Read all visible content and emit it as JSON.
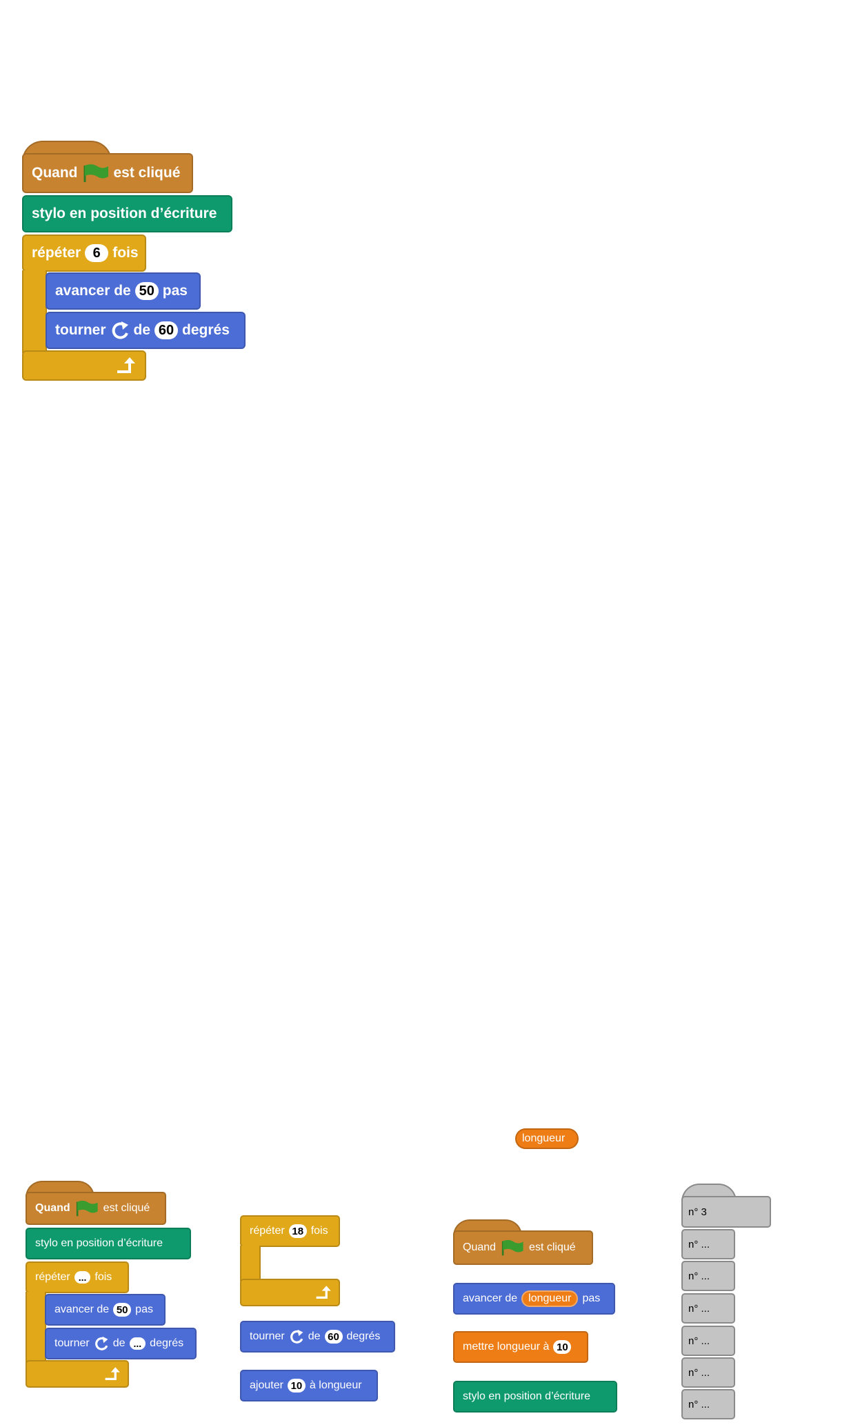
{
  "script1": {
    "hat_pre": "Quand",
    "hat_post": "est cliqué",
    "pen_down": "stylo en position d’écriture",
    "repeat_pre": "répéter",
    "repeat_count": "6",
    "repeat_post": "fois",
    "move_pre": "avancer de",
    "move_steps": "50",
    "move_post": "pas",
    "turn_pre": "tourner",
    "turn_mid": "de",
    "turn_angle": "60",
    "turn_post": "degrés"
  },
  "palette_a": {
    "hat_pre": "Quand",
    "hat_post": "est cliqué",
    "pen_down": "stylo en position d’écriture",
    "repeat_pre": "répéter",
    "repeat_count": "...",
    "repeat_post": "fois",
    "move_pre": "avancer de",
    "move_steps": "50",
    "move_post": "pas",
    "turn_pre": "tourner",
    "turn_mid": "de",
    "turn_angle": "...",
    "turn_post": "degrés"
  },
  "palette_b": {
    "repeat_pre": "répéter",
    "repeat_count": "18",
    "repeat_post": "fois",
    "turn_pre": "tourner",
    "turn_mid": "de",
    "turn_angle": "60",
    "turn_post": "degrés",
    "add_pre": "ajouter",
    "add_value": "10",
    "add_post": "à longueur"
  },
  "palette_c": {
    "variable": "longueur",
    "hat_pre": "Quand",
    "hat_post": "est cliqué",
    "move_pre": "avancer de",
    "move_var": "longueur",
    "move_post": "pas",
    "set_pre": "mettre longueur à",
    "set_value": "10",
    "pen_down": "stylo en position d’écriture"
  },
  "palette_d": {
    "slots": [
      "n° 3",
      "n° ...",
      "n° ...",
      "n° ...",
      "n° ...",
      "n° ...",
      "n° ..."
    ]
  },
  "colors": {
    "event": "#c88330",
    "pen": "#0e9a6c",
    "control": "#e1a91a",
    "motion": "#4c6cd6",
    "variables": "#ee7d16",
    "flag": "#3a9b2e",
    "placeholder": "#c4c4c4"
  },
  "icons": {
    "flag": "green-flag-icon",
    "turn": "rotate-clockwise-icon",
    "loop_end": "loop-arrow-icon"
  }
}
